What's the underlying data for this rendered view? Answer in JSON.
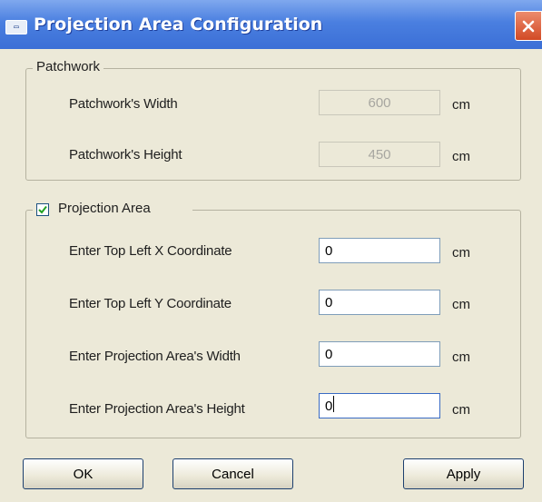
{
  "window": {
    "title": "Projection Area Configuration",
    "icon": "app-window-icon",
    "close_icon": "close-icon"
  },
  "patchwork": {
    "legend": "Patchwork",
    "width_label": "Patchwork's Width",
    "width_value": "600",
    "width_unit": "cm",
    "height_label": "Patchwork's Height",
    "height_value": "450",
    "height_unit": "cm"
  },
  "projection": {
    "legend": "Projection Area",
    "checked": true,
    "x_label": "Enter Top Left X Coordinate",
    "x_value": "0",
    "x_unit": "cm",
    "y_label": "Enter Top Left Y Coordinate",
    "y_value": "0",
    "y_unit": "cm",
    "width_label": "Enter Projection Area's Width",
    "width_value": "0",
    "width_unit": "cm",
    "height_label": "Enter Projection Area's Height",
    "height_value": "0",
    "height_unit": "cm"
  },
  "buttons": {
    "ok": "OK",
    "cancel": "Cancel",
    "apply": "Apply"
  },
  "colors": {
    "titlebar": "#3b6fd6",
    "close": "#d24a25",
    "dialog_bg": "#ece9d8"
  }
}
